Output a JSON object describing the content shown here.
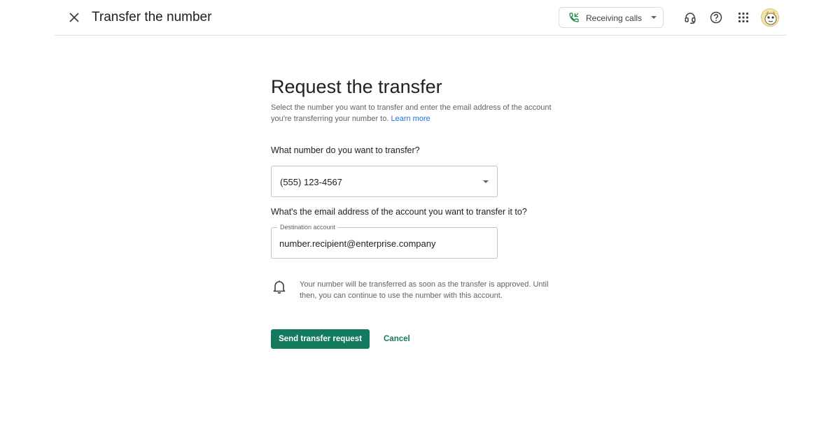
{
  "header": {
    "title": "Transfer the number",
    "status": {
      "label": "Receiving calls",
      "icon": "phone-incoming-icon",
      "accent": "#188038"
    },
    "icons": [
      "headset-icon",
      "help-icon",
      "apps-grid-icon",
      "avatar"
    ]
  },
  "main": {
    "heading": "Request the transfer",
    "description": "Select the number you want to transfer and enter the email address of the account you're transferring your number to.",
    "learn_more": "Learn more",
    "number_question": "What number do you want to transfer?",
    "number_selected": "(555) 123-4567",
    "email_question": "What's the email address of the account you want to transfer it to?",
    "destination_label": "Destination account",
    "destination_value": "number.recipient@enterprise.company",
    "notice": "Your number will be transferred as soon as the transfer is approved. Until then, you can continue to use the number with this account.",
    "notice_icon": "bell-icon"
  },
  "actions": {
    "send_label": "Send transfer request",
    "cancel_label": "Cancel"
  },
  "colors": {
    "primary": "#137a5f",
    "link": "#1a73e8",
    "text": "#202124",
    "muted": "#5f6368"
  }
}
